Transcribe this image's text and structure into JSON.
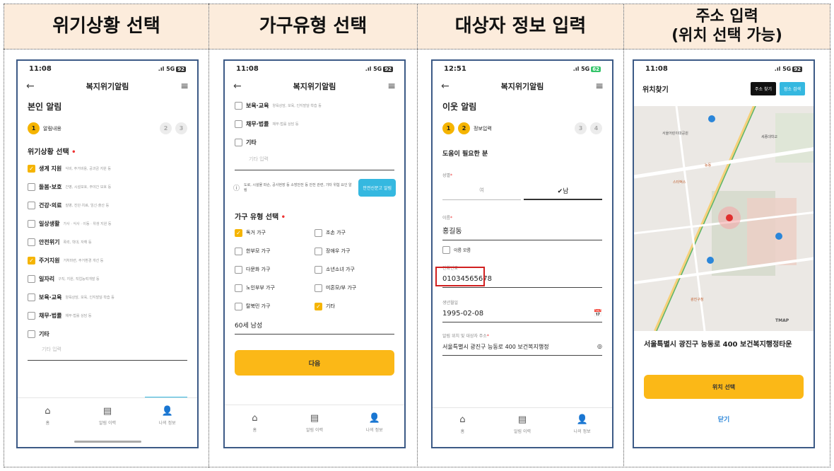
{
  "headers": [
    "위기상황 선택",
    "가구유형 선택",
    "대상자 정보 입력",
    "주소 입력",
    "(위치 선택 가능)"
  ],
  "status": {
    "time1": "11:08",
    "time3": "12:51",
    "signal": ".ıl 5G",
    "battery1": "92",
    "battery3": "62"
  },
  "app_title": "복지위기알림",
  "p1": {
    "title": "본인 알림",
    "step_label": "알림내용",
    "section": "위기상황 선택",
    "items": [
      {
        "main": "생계 지원",
        "sub": "식비, 주거비용, 공과금 지원 등",
        "checked": true
      },
      {
        "main": "돌봄·보호",
        "sub": "간병, 시설보호, 주야간 보호 등",
        "checked": false
      },
      {
        "main": "건강·의료",
        "sub": "질병, 진단·치료, 임신·출산 등",
        "checked": false
      },
      {
        "main": "일상생활",
        "sub": "가사 · 식사 · 이동 · 위생 지원 등",
        "checked": false
      },
      {
        "main": "안전위기",
        "sub": "폭력, 학대, 자해 등",
        "checked": false
      },
      {
        "main": "주거지원",
        "sub": "거처마련, 주거환경 개선 등",
        "checked": true
      },
      {
        "main": "일자리",
        "sub": "구직, 지원, 직업능력개발 등",
        "checked": false
      },
      {
        "main": "보육·교육",
        "sub": "양육상담, 보육, 인지발달·학습 등",
        "checked": false
      },
      {
        "main": "채무·법률",
        "sub": "채무·법률 상담 등",
        "checked": false
      },
      {
        "main": "기타",
        "sub": "",
        "checked": false
      }
    ],
    "other_placeholder": "기타 입력"
  },
  "tabs": [
    "홈",
    "알림 이력",
    "나의 정보"
  ],
  "p2": {
    "top_items": [
      {
        "main": "보육·교육",
        "sub": "양육상담, 보육, 인지발달·학습 등"
      },
      {
        "main": "채무·법률",
        "sub": "채무·법률 상담 등"
      },
      {
        "main": "기타",
        "sub": ""
      }
    ],
    "other_placeholder": "기타 입력",
    "info_text": "도로, 시설물 파손, 공사현장 등 소방안전 등 안전 관련, 기타 위험 요인 알림",
    "info_button": "안전신문고 알림",
    "section": "가구 유형 선택",
    "types": [
      {
        "label": "독거 가구",
        "checked": true
      },
      {
        "label": "조손 가구",
        "checked": false
      },
      {
        "label": "한부모 가구",
        "checked": false
      },
      {
        "label": "장애우 가구",
        "checked": false
      },
      {
        "label": "다문화 가구",
        "checked": false
      },
      {
        "label": "소년소녀 가구",
        "checked": false
      },
      {
        "label": "노인부부 가구",
        "checked": false
      },
      {
        "label": "미혼모/부 가구",
        "checked": false
      },
      {
        "label": "탈북민 가구",
        "checked": false
      },
      {
        "label": "기타",
        "checked": true
      }
    ],
    "other_value": "60세 남성",
    "next_button": "다음"
  },
  "p3": {
    "title": "이웃 알림",
    "step_label": "정보입력",
    "section": "도움이 필요한 분",
    "gender_label": "성별",
    "gender_f": "여",
    "gender_m": "✔남",
    "name_label": "이름",
    "name_value": "홍길동",
    "unknown_name": "이름 모름",
    "phone_label": "전화번호",
    "phone_value": "01034565678",
    "birth_label": "생년월일",
    "birth_value": "1995-02-08",
    "address_label": "알림 위치 및 대상자 주소",
    "address_value": "서울특별시 광진구 능동로 400 보건복지행정"
  },
  "p4": {
    "title": "위치찾기",
    "btn_find": "주소 찾기",
    "btn_place": "장소 검색",
    "map_labels": [
      "서울어린이대공원",
      "스타벅스",
      "능동",
      "세종대학교",
      "광진구청"
    ],
    "map_brand": "TMAP",
    "address": "서울특별시 광진구 능동로 400 보건복지행정타운",
    "select_button": "위치 선택",
    "close_button": "닫기"
  },
  "colors": {
    "accent": "#fbb817",
    "cyan": "#35b8e0",
    "header_bg": "#fcecdc",
    "frame": "#3c5a86"
  }
}
